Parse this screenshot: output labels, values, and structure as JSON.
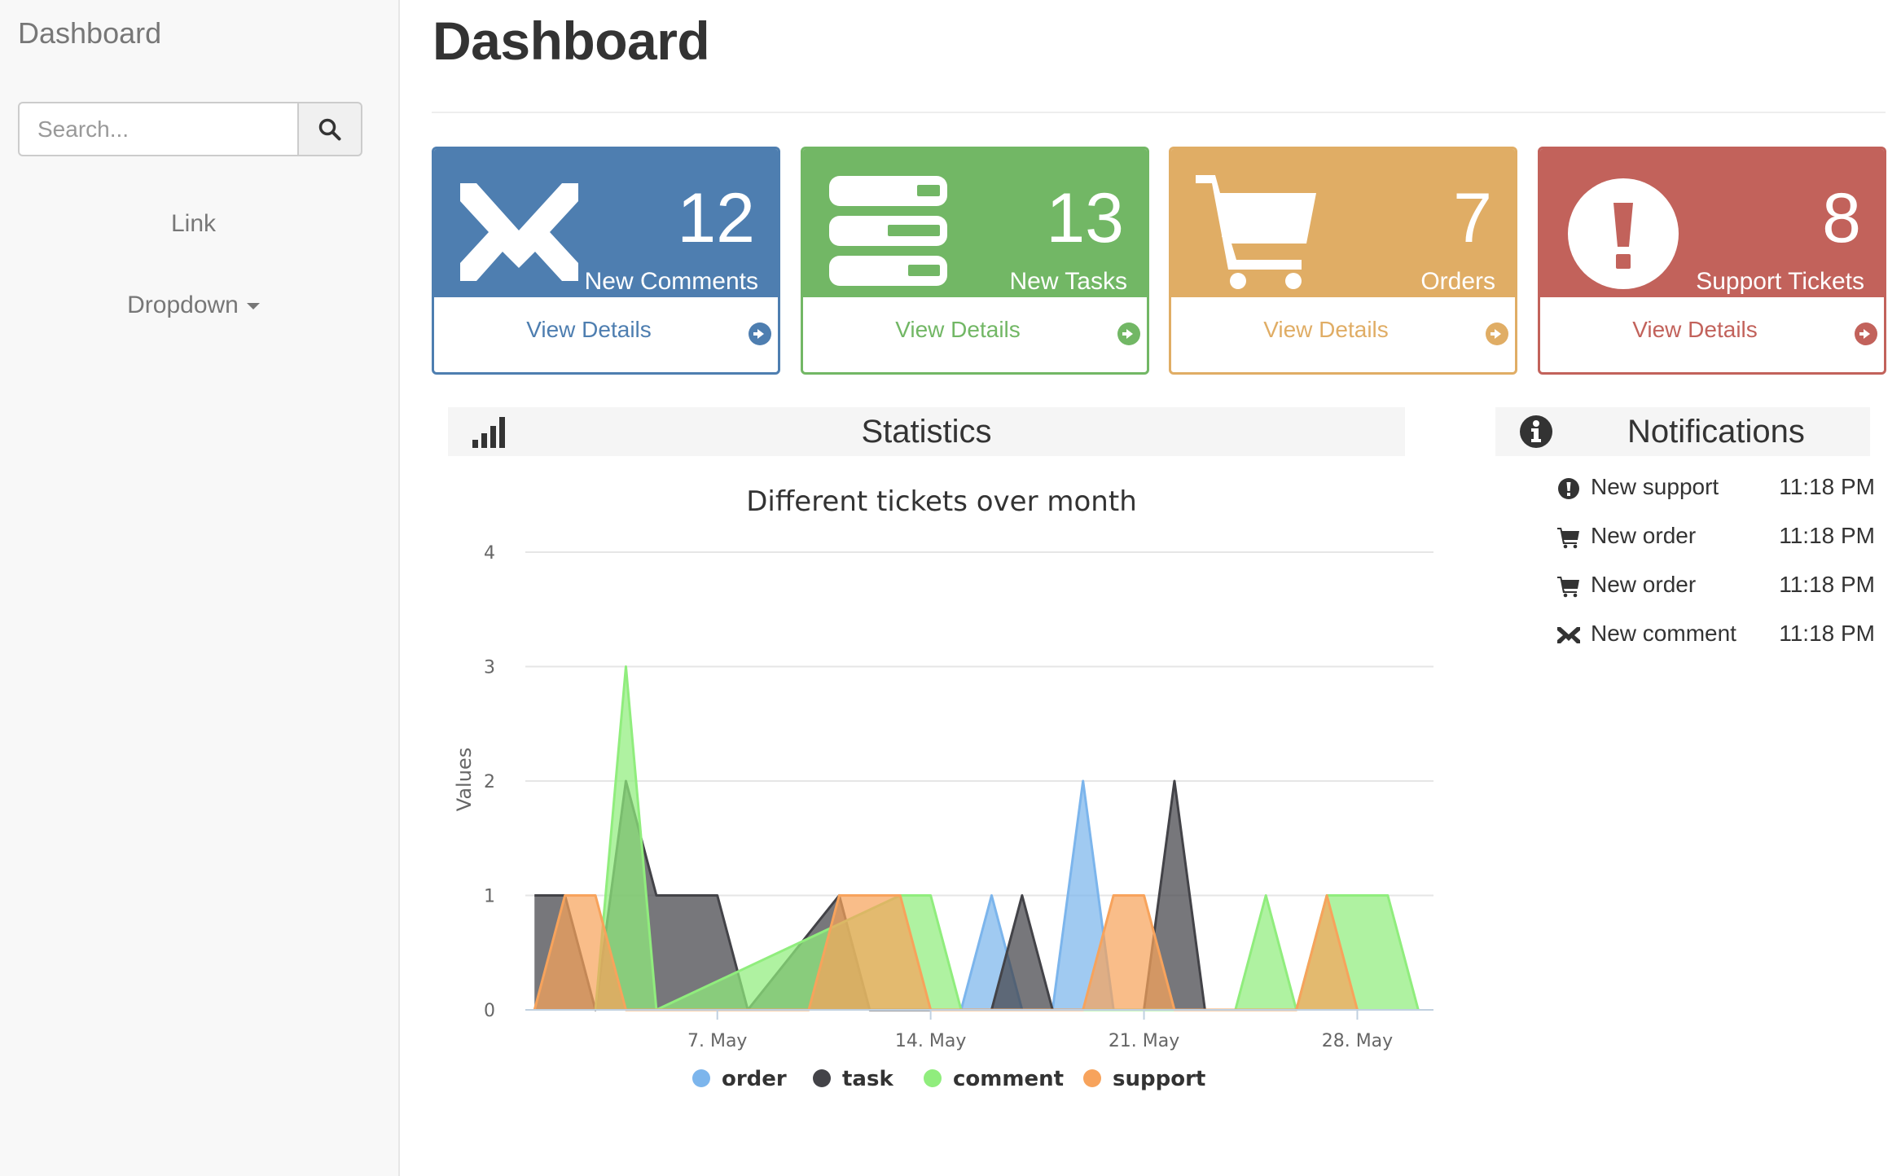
{
  "sidebar": {
    "brand": "Dashboard",
    "search": {
      "placeholder": "Search..."
    },
    "nav": [
      {
        "label": "Link"
      },
      {
        "label": "Dropdown"
      }
    ]
  },
  "page": {
    "title": "Dashboard"
  },
  "panels": [
    {
      "count": "12",
      "label": "New Comments",
      "link": "View Details",
      "color": "#4e7eb0",
      "icon": "envelope-icon"
    },
    {
      "count": "13",
      "label": "New Tasks",
      "link": "View Details",
      "color": "#72b765",
      "icon": "tasks-icon"
    },
    {
      "count": "7",
      "label": "Orders",
      "link": "View Details",
      "color": "#e0ad65",
      "icon": "cart-icon"
    },
    {
      "count": "8",
      "label": "Support Tickets",
      "link": "View Details",
      "color": "#c2625b",
      "icon": "exclamation-icon"
    }
  ],
  "statistics": {
    "title": "Statistics",
    "icon": "signal-icon"
  },
  "notifications": {
    "title": "Notifications",
    "icon": "info-icon",
    "items": [
      {
        "icon": "exclamation-icon",
        "text": "New support",
        "time": "11:18 PM"
      },
      {
        "icon": "cart-icon",
        "text": "New order",
        "time": "11:18 PM"
      },
      {
        "icon": "cart-icon",
        "text": "New order",
        "time": "11:18 PM"
      },
      {
        "icon": "envelope-icon",
        "text": "New comment",
        "time": "11:18 PM"
      }
    ]
  },
  "chart_data": {
    "type": "area",
    "title": "Different tickets over month",
    "xlabel": "",
    "ylabel": "Values",
    "ylim": [
      0,
      4
    ],
    "yticks": [
      0,
      1,
      2,
      3,
      4
    ],
    "xticks": [
      {
        "day": 7,
        "label": "7. May"
      },
      {
        "day": 14,
        "label": "14. May"
      },
      {
        "day": 21,
        "label": "21. May"
      },
      {
        "day": 28,
        "label": "28. May"
      }
    ],
    "xlim": [
      0.7,
      30.5
    ],
    "grid": true,
    "legend_position": "bottom",
    "series": [
      {
        "name": "order",
        "color": "#7cb5ec",
        "points": [
          [
            15,
            0
          ],
          [
            16,
            1
          ],
          [
            17,
            0
          ],
          [
            18,
            0
          ],
          [
            19,
            2
          ],
          [
            20,
            0
          ]
        ]
      },
      {
        "name": "task",
        "color": "#434348",
        "points": [
          [
            1,
            1
          ],
          [
            2,
            1
          ],
          [
            3,
            0
          ],
          [
            4,
            2
          ],
          [
            5,
            1
          ],
          [
            6,
            1
          ],
          [
            7,
            1
          ],
          [
            8,
            0
          ],
          [
            11,
            1
          ],
          [
            12,
            0
          ],
          [
            16,
            0
          ],
          [
            17,
            1
          ],
          [
            18,
            0
          ],
          [
            21,
            0
          ],
          [
            22,
            2
          ],
          [
            23,
            0
          ]
        ]
      },
      {
        "name": "comment",
        "color": "#90ed7d",
        "points": [
          [
            3,
            0
          ],
          [
            4,
            3
          ],
          [
            5,
            0
          ],
          [
            13,
            1
          ],
          [
            14,
            1
          ],
          [
            15,
            0
          ],
          [
            24,
            0
          ],
          [
            25,
            1
          ],
          [
            26,
            0
          ],
          [
            27,
            1
          ],
          [
            28,
            1
          ],
          [
            29,
            1
          ],
          [
            30,
            0
          ]
        ]
      },
      {
        "name": "support",
        "color": "#f7a35c",
        "points": [
          [
            1,
            0
          ],
          [
            2,
            1
          ],
          [
            3,
            1
          ],
          [
            4,
            0
          ],
          [
            10,
            0
          ],
          [
            11,
            1
          ],
          [
            12,
            1
          ],
          [
            13,
            1
          ],
          [
            14,
            0
          ],
          [
            18,
            0
          ],
          [
            19,
            0
          ],
          [
            20,
            1
          ],
          [
            21,
            1
          ],
          [
            22,
            0
          ],
          [
            26,
            0
          ],
          [
            27,
            1
          ],
          [
            28,
            0
          ]
        ]
      }
    ]
  }
}
